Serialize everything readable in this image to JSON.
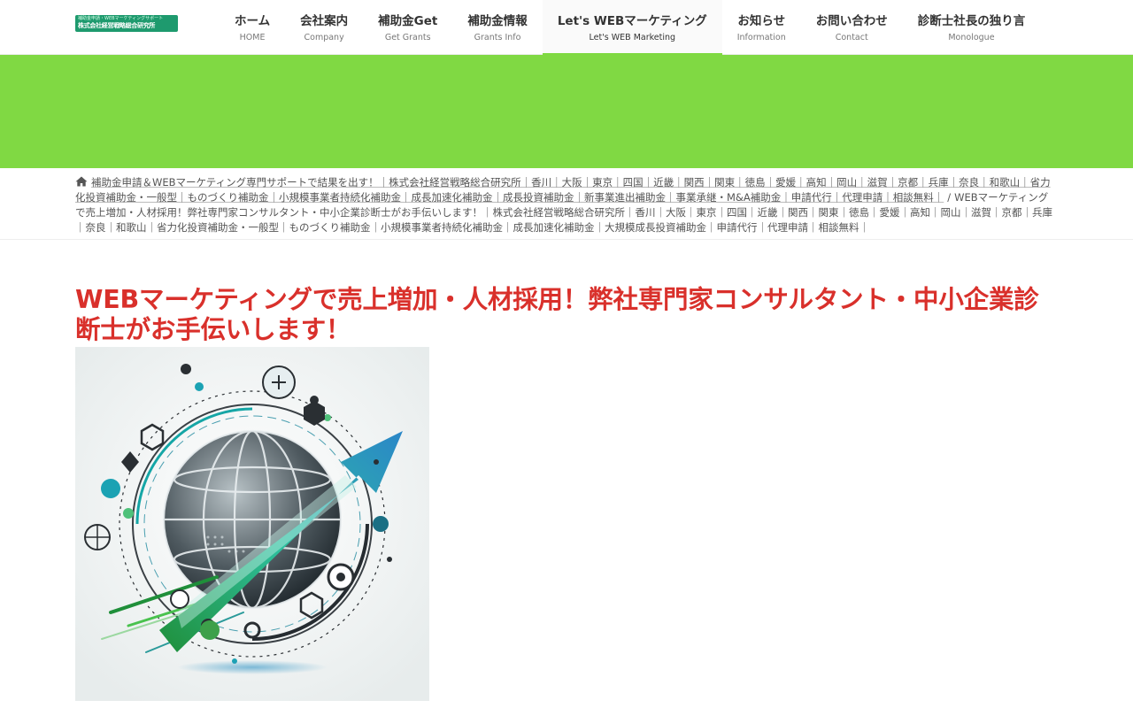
{
  "logo": {
    "line1": "補助金申請・WEBマーケティングサポート",
    "line2": "株式会社経営戦略総合研究所"
  },
  "nav": {
    "items": [
      {
        "label": "ホーム",
        "sub": "HOME"
      },
      {
        "label": "会社案内",
        "sub": "Company"
      },
      {
        "label": "補助金Get",
        "sub": "Get Grants"
      },
      {
        "label": "補助金情報",
        "sub": "Grants Info"
      },
      {
        "label": "Let's WEBマーケティング",
        "sub": "Let's WEB Marketing"
      },
      {
        "label": "お知らせ",
        "sub": "Information"
      },
      {
        "label": "お問い合わせ",
        "sub": "Contact"
      },
      {
        "label": "診断士社長の独り言",
        "sub": "Monologue"
      }
    ],
    "active_index": 4
  },
  "breadcrumb": {
    "home_link": "補助金申請＆WEBマーケティング専門サポートで結果を出す！｜株式会社経営戦略総合研究所｜香川｜大阪｜東京｜四国｜近畿｜関西｜関東｜徳島｜愛媛｜高知｜岡山｜滋賀｜京都｜兵庫｜奈良｜和歌山｜省力化投資補助金・一般型｜ものづくり補助金｜小規模事業者持続化補助金｜成長加速化補助金｜成長投資補助金｜新事業進出補助金｜事業承継・M&A補助金｜申請代行｜代理申請｜相談無料｜",
    "separator": "/",
    "current": "WEBマーケティングで売上増加・人材採用！弊社専門家コンサルタント・中小企業診断士がお手伝いします！｜株式会社経営戦略総合研究所｜香川｜大阪｜東京｜四国｜近畿｜関西｜関東｜徳島｜愛媛｜高知｜岡山｜滋賀｜京都｜兵庫｜奈良｜和歌山｜省力化投資補助金・一般型｜ものづくり補助金｜小規模事業者持続化補助金｜成長加速化補助金｜大規模成長投資補助金｜申請代行｜代理申請｜相談無料｜"
  },
  "page": {
    "title": "WEBマーケティングで売上増加・人材採用！弊社専門家コンサルタント・中小企業診断士がお手伝いします！"
  },
  "colors": {
    "accent_green": "#80d943",
    "title_red": "#d9302b",
    "logo_green": "#1e9a6e"
  }
}
